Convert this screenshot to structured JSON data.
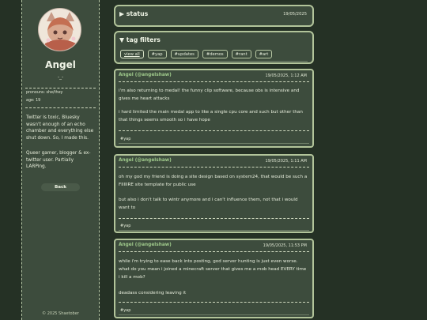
{
  "profile": {
    "name": "Angel",
    "emote": "-_-",
    "pronouns": "pronouns: she/they",
    "age": "age: 19",
    "bio_1": "Twitter is toxic, Bluesky wasn't enough of an echo chamber and everything else shut down. So, I made this.",
    "bio_2": "Queer gamer, blogger & ex-twitter user. Partially LARPing.",
    "back_label": "Back",
    "footer": "© 2025 Shaetober"
  },
  "status_panel": {
    "title": "▶ status",
    "date": "19/05/2025"
  },
  "tag_panel": {
    "title": "▼ tag filters",
    "tags": [
      "view all",
      "#yap",
      "#updates",
      "#demos",
      "#rant",
      "#art"
    ]
  },
  "posts": [
    {
      "author": "Angel (@angelshaw)",
      "date": "19/05/2025, 1:12 AM",
      "paragraphs": [
        "i'm also returning to medal! the funny clip software, because obs is intensive and gives me heart attacks",
        "i hard limited the main medal app to like a single cpu core and such but other than that things seems smooth so i have hope"
      ],
      "tag": "#yap"
    },
    {
      "author": "Angel (@angelshaw)",
      "date": "19/05/2025, 1:11 AM",
      "paragraphs": [
        "oh my god my friend is doing a site design based on system24, that would be such a FIIIIIRE site template for public use",
        "but also i don't talk to wintr anymore and i can't influence them, not that i would want to"
      ],
      "tag": "#yap"
    },
    {
      "author": "Angel (@angelshaw)",
      "date": "19/05/2025, 11:53 PM",
      "paragraphs": [
        "while i'm trying to ease back into posting, god server hunting is just even worse. what do you mean i joined a minecraft server that gives me a mob head EVERY time i kill a mob?",
        "deadass considering leaving it"
      ],
      "tag": "#yap"
    }
  ],
  "colors": {
    "background": "#253125",
    "panel": "#3d4c3d",
    "border": "#b2c49a",
    "author": "#9fc98b"
  }
}
